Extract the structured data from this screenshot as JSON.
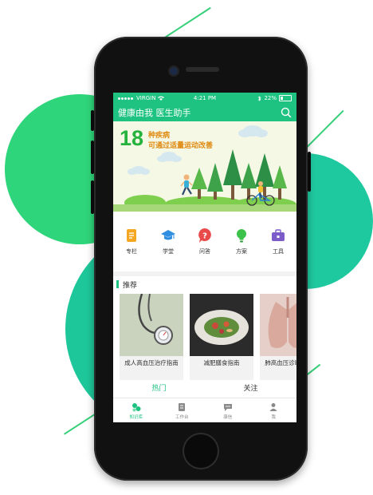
{
  "status_bar": {
    "carrier": "VIRGIN",
    "time": "4:21 PM",
    "battery": "22%"
  },
  "app_bar": {
    "title": "健康由我 医生助手",
    "icon": "search-icon"
  },
  "banner": {
    "number": "18",
    "line1": "种疾病",
    "line2": "可通过适量运动改善"
  },
  "quick_menu": [
    {
      "label": "专栏",
      "icon": "column-icon",
      "color": "#f5a623"
    },
    {
      "label": "学堂",
      "icon": "graduation-cap-icon",
      "color": "#2f8ee0"
    },
    {
      "label": "问答",
      "icon": "question-icon",
      "color": "#e94b4b"
    },
    {
      "label": "方案",
      "icon": "lightbulb-icon",
      "color": "#3cc24a"
    },
    {
      "label": "工具",
      "icon": "toolbox-icon",
      "color": "#7b5cc8"
    }
  ],
  "recommend": {
    "title": "推荐",
    "cards": [
      {
        "title": "成人高血压治疗指南",
        "image": "stethoscope-photo"
      },
      {
        "title": "减肥膳食指南",
        "image": "salad-photo"
      },
      {
        "title": "肺高血压诊断和治疗",
        "image": "lungs-photo"
      }
    ]
  },
  "feed_tabs": {
    "hot": "热门",
    "follow": "关注"
  },
  "bottom_nav": [
    {
      "label": "知识库",
      "icon": "knowledge-icon",
      "active": true
    },
    {
      "label": "工作台",
      "icon": "workbench-icon",
      "active": false
    },
    {
      "label": "康信",
      "icon": "chat-icon",
      "active": false
    },
    {
      "label": "我",
      "icon": "profile-icon",
      "active": false
    }
  ],
  "colors": {
    "brand": "#1ec281",
    "banner_bg": "#f4f8e4",
    "number": "#25b33d",
    "banner_text": "#e08a12"
  }
}
